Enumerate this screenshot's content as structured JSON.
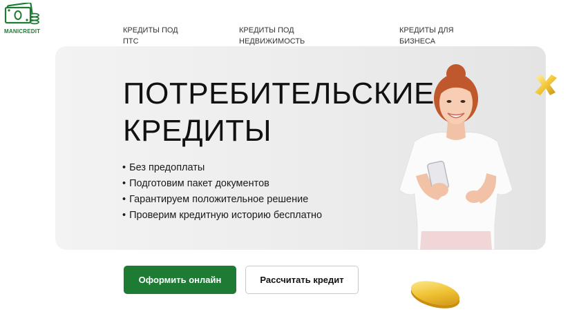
{
  "brand": {
    "name": "MANICREDIT",
    "logo_icon": "money-stack-icon",
    "color": "#1f7a34"
  },
  "nav": {
    "items": [
      {
        "line1": "КРЕДИТЫ ПОД",
        "line2": "ПТС"
      },
      {
        "line1": "КРЕДИТЫ ПОД",
        "line2": "НЕДВИЖИМОСТЬ"
      },
      {
        "line1": "КРЕДИТЫ ДЛЯ",
        "line2": "БИЗНЕСА"
      }
    ]
  },
  "hero": {
    "title_line1": "ПОТРЕБИТЕЛЬСКИЕ",
    "title_line2": "КРЕДИТЫ",
    "bullets": [
      "Без предоплаты",
      "Подготовим пакет документов",
      "Гарантируем положительное решение",
      "Проверим кредитную историю бесплатно"
    ],
    "image": "smiling-woman-with-phone"
  },
  "actions": {
    "primary_label": "Оформить онлайн",
    "secondary_label": "Рассчитать кредит",
    "primary_color": "#1e7b34"
  },
  "decorations": [
    "gold-x-icon",
    "gold-coin-icon"
  ]
}
